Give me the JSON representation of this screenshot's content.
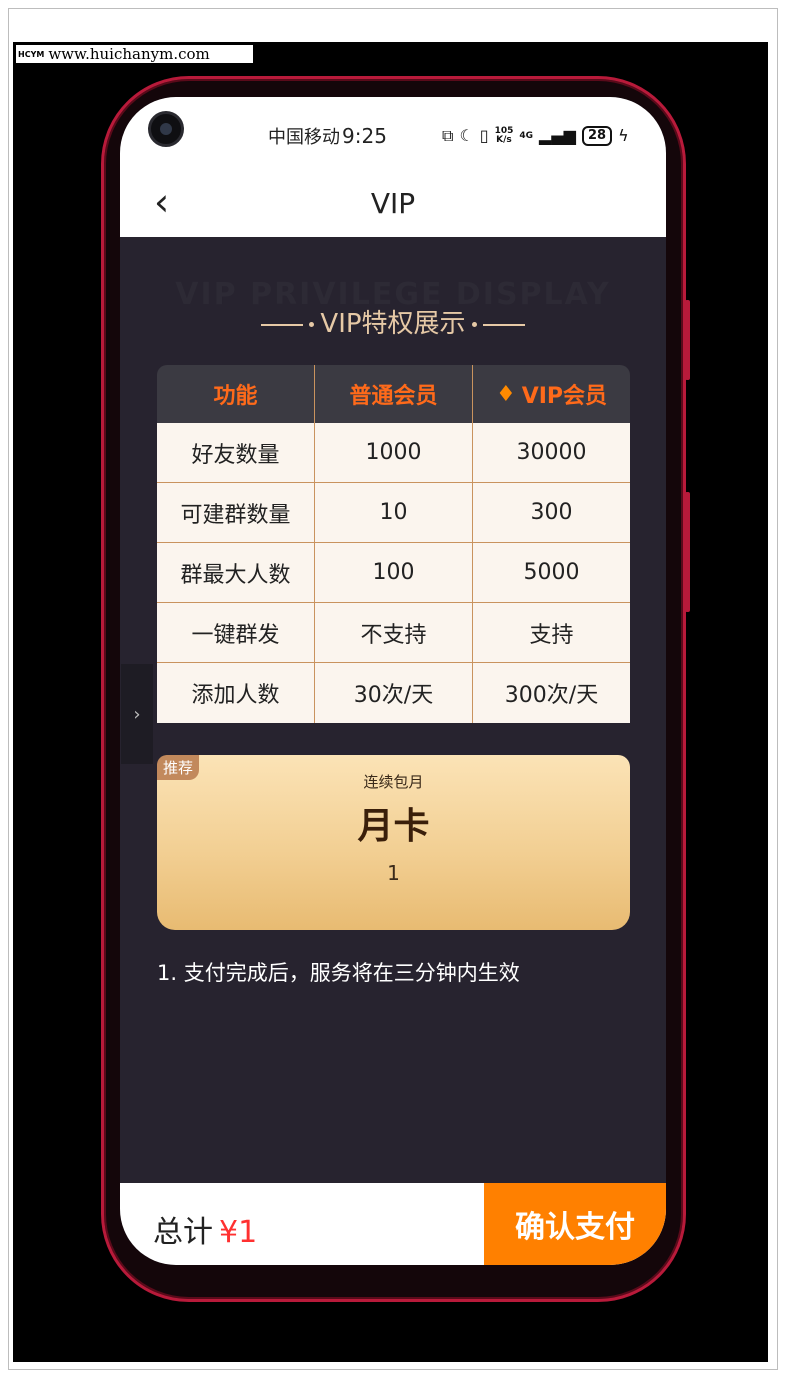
{
  "watermark": {
    "logo": "HCYM",
    "text": "www.huichanym.com"
  },
  "status_bar": {
    "carrier": "中国移动",
    "time": "9:25",
    "speed_value": "105",
    "speed_unit": "K/s",
    "network": "4G",
    "battery": "28"
  },
  "nav": {
    "back_icon": "‹",
    "title": "VIP"
  },
  "section": {
    "heading_bg": "VIP PRIVILEGE DISPLAY",
    "heading": "VIP特权展示"
  },
  "table": {
    "headers": [
      "功能",
      "普通会员",
      "VIP会员"
    ],
    "rows": [
      [
        "好友数量",
        "1000",
        "30000"
      ],
      [
        "可建群数量",
        "10",
        "300"
      ],
      [
        "群最大人数",
        "100",
        "5000"
      ],
      [
        "一键群发",
        "不支持",
        "支持"
      ],
      [
        "添加人数",
        "30次/天",
        "300次/天"
      ]
    ]
  },
  "side_tab": {
    "icon": "›"
  },
  "plan": {
    "badge": "推荐",
    "subtitle": "连续包月",
    "name": "月卡",
    "price": "1"
  },
  "note": "1. 支付完成后，服务将在三分钟内生效",
  "footer": {
    "total_label": "总计",
    "total_amount": "¥1",
    "pay_button": "确认支付"
  },
  "colors": {
    "accent_orange": "#ff8000",
    "header_orange": "#ff6a1a",
    "price_red": "#ff3030",
    "gold": "#e6c9a6",
    "dark_bg": "#27232f",
    "phone_frame": "#b81a3a"
  }
}
